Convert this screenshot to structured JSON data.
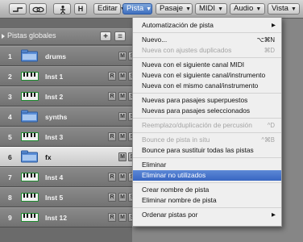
{
  "toolbar": {
    "menus": [
      {
        "id": "editar",
        "label": "Editar",
        "active": false
      },
      {
        "id": "pista",
        "label": "Pista",
        "active": true
      },
      {
        "id": "pasaje",
        "label": "Pasaje",
        "active": false
      },
      {
        "id": "midi",
        "label": "MIDI",
        "active": false
      },
      {
        "id": "audio",
        "label": "Audio",
        "active": false
      },
      {
        "id": "vista",
        "label": "Vista",
        "active": false
      }
    ],
    "arrow_glyph": "▼",
    "h_label": "H"
  },
  "global_tracks": {
    "label": "Pistas globales"
  },
  "tracks": [
    {
      "number": "1",
      "name": "drums",
      "type": "folder",
      "selected": false,
      "show_r": false
    },
    {
      "number": "2",
      "name": "Inst 1",
      "type": "instrument",
      "selected": false,
      "show_r": true
    },
    {
      "number": "3",
      "name": "Inst 2",
      "type": "instrument",
      "selected": false,
      "show_r": true
    },
    {
      "number": "4",
      "name": "synths",
      "type": "folder",
      "selected": false,
      "show_r": false
    },
    {
      "number": "5",
      "name": "Inst 3",
      "type": "instrument",
      "selected": false,
      "show_r": true
    },
    {
      "number": "6",
      "name": "fx",
      "type": "folder",
      "selected": true,
      "show_r": false
    },
    {
      "number": "7",
      "name": "Inst 4",
      "type": "instrument",
      "selected": false,
      "show_r": true
    },
    {
      "number": "8",
      "name": "Inst 5",
      "type": "instrument",
      "selected": false,
      "show_r": true
    },
    {
      "number": "9",
      "name": "Inst 12",
      "type": "instrument",
      "selected": false,
      "show_r": true
    }
  ],
  "track_buttons": {
    "r": "R",
    "m": "M",
    "s": "S"
  },
  "pista_menu": {
    "items": [
      {
        "label": "Automatización de pista",
        "shortcut": "",
        "submenu": true,
        "disabled": false,
        "highlighted": false
      },
      {
        "sep": true
      },
      {
        "label": "Nuevo...",
        "shortcut": "⌥⌘N",
        "submenu": false,
        "disabled": false,
        "highlighted": false
      },
      {
        "label": "Nueva con ajustes duplicados",
        "shortcut": "⌘D",
        "submenu": false,
        "disabled": true,
        "highlighted": false
      },
      {
        "sep": true
      },
      {
        "label": "Nueva con el siguiente canal MIDI",
        "shortcut": "",
        "submenu": false,
        "disabled": false,
        "highlighted": false
      },
      {
        "label": "Nueva con el siguiente canal/instrumento",
        "shortcut": "",
        "submenu": false,
        "disabled": false,
        "highlighted": false
      },
      {
        "label": "Nueva con el mismo canal/instrumento",
        "shortcut": "",
        "submenu": false,
        "disabled": false,
        "highlighted": false
      },
      {
        "sep": true
      },
      {
        "label": "Nuevas para pasajes superpuestos",
        "shortcut": "",
        "submenu": false,
        "disabled": false,
        "highlighted": false
      },
      {
        "label": "Nuevas para pasajes seleccionados",
        "shortcut": "",
        "submenu": false,
        "disabled": false,
        "highlighted": false
      },
      {
        "sep": true
      },
      {
        "label": "Reemplazo/duplicación de percusión",
        "shortcut": "^D",
        "submenu": false,
        "disabled": true,
        "highlighted": false
      },
      {
        "sep": true
      },
      {
        "label": "Bounce de pista in situ",
        "shortcut": "^⌘B",
        "submenu": false,
        "disabled": true,
        "highlighted": false
      },
      {
        "label": "Bounce para sustituir todas las pistas",
        "shortcut": "",
        "submenu": false,
        "disabled": false,
        "highlighted": false
      },
      {
        "sep": true
      },
      {
        "label": "Eliminar",
        "shortcut": "",
        "submenu": false,
        "disabled": false,
        "highlighted": false
      },
      {
        "label": "Eliminar no utilizados",
        "shortcut": "",
        "submenu": false,
        "disabled": false,
        "highlighted": true
      },
      {
        "sep": true
      },
      {
        "label": "Crear nombre de pista",
        "shortcut": "",
        "submenu": false,
        "disabled": false,
        "highlighted": false
      },
      {
        "label": "Eliminar nombre de pista",
        "shortcut": "",
        "submenu": false,
        "disabled": false,
        "highlighted": false
      },
      {
        "sep": true
      },
      {
        "label": "Ordenar pistas por",
        "shortcut": "",
        "submenu": true,
        "disabled": false,
        "highlighted": false
      }
    ],
    "submenu_glyph": "▶"
  },
  "colors": {
    "highlight": "#3866c2",
    "folder_icon": "#5c8fd8",
    "instrument_icon": "#1d8a2e"
  }
}
